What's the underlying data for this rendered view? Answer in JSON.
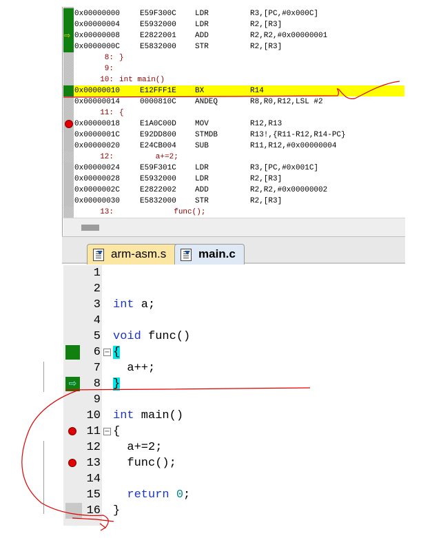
{
  "disassembly": [
    {
      "kind": "asm",
      "addr": "0x00000000",
      "hex": "E59F300C",
      "op": "LDR",
      "args": "R3,[PC,#0x000C]",
      "marker": "green"
    },
    {
      "kind": "asm",
      "addr": "0x00000004",
      "hex": "E5932000",
      "op": "LDR",
      "args": "R2,[R3]",
      "marker": "green"
    },
    {
      "kind": "asm",
      "addr": "0x00000008",
      "hex": "E2822001",
      "op": "ADD",
      "args": "R2,R2,#0x00000001",
      "marker": "arrow"
    },
    {
      "kind": "asm",
      "addr": "0x0000000C",
      "hex": "E5832000",
      "op": "STR",
      "args": "R2,[R3]",
      "marker": "green"
    },
    {
      "kind": "src",
      "num": "8:",
      "code": "}"
    },
    {
      "kind": "src",
      "num": "9:",
      "code": ""
    },
    {
      "kind": "src",
      "num": "10:",
      "code": "int main()"
    },
    {
      "kind": "asm",
      "addr": "0x00000010",
      "hex": "E12FFF1E",
      "op": "BX",
      "args": "R14",
      "marker": "green",
      "highlight": true
    },
    {
      "kind": "asm",
      "addr": "0x00000014",
      "hex": "0000810C",
      "op": "ANDEQ",
      "args": "R8,R0,R12,LSL #2"
    },
    {
      "kind": "src",
      "num": "11:",
      "code": "{"
    },
    {
      "kind": "asm",
      "addr": "0x00000018",
      "hex": "E1A0C00D",
      "op": "MOV",
      "args": "R12,R13",
      "marker": "bp"
    },
    {
      "kind": "asm",
      "addr": "0x0000001C",
      "hex": "E92DD800",
      "op": "STMDB",
      "args": "R13!,{R11-R12,R14-PC}",
      "marker": "gray"
    },
    {
      "kind": "asm",
      "addr": "0x00000020",
      "hex": "E24CB004",
      "op": "SUB",
      "args": "R11,R12,#0x00000004",
      "marker": "gray"
    },
    {
      "kind": "src",
      "num": "12:",
      "code": "        a+=2;"
    },
    {
      "kind": "asm",
      "addr": "0x00000024",
      "hex": "E59F301C",
      "op": "LDR",
      "args": "R3,[PC,#0x001C]",
      "marker": "gray"
    },
    {
      "kind": "asm",
      "addr": "0x00000028",
      "hex": "E5932000",
      "op": "LDR",
      "args": "R2,[R3]",
      "marker": "gray"
    },
    {
      "kind": "asm",
      "addr": "0x0000002C",
      "hex": "E2822002",
      "op": "ADD",
      "args": "R2,R2,#0x00000002",
      "marker": "gray"
    },
    {
      "kind": "asm",
      "addr": "0x00000030",
      "hex": "E5832000",
      "op": "STR",
      "args": "R2,[R3]",
      "marker": "gray"
    },
    {
      "kind": "src",
      "num": "13:",
      "code": "            func();"
    }
  ],
  "tabs": [
    {
      "label": "arm-asm.s",
      "active": false,
      "color": "#fbe6a3"
    },
    {
      "label": "main.c",
      "active": true,
      "color": "#dfe8f5"
    }
  ],
  "editor": [
    {
      "n": "1",
      "parts": []
    },
    {
      "n": "2",
      "parts": []
    },
    {
      "n": "3",
      "parts": [
        {
          "t": "int",
          "c": "kw"
        },
        {
          "t": " a;"
        }
      ]
    },
    {
      "n": "4",
      "parts": []
    },
    {
      "n": "5",
      "parts": [
        {
          "t": "void",
          "c": "kw"
        },
        {
          "t": " func()"
        }
      ]
    },
    {
      "n": "6",
      "marker": "green",
      "fold": true,
      "parts": [
        {
          "t": "{",
          "c": "brace-hl"
        }
      ]
    },
    {
      "n": "7",
      "parts": [
        {
          "t": "  a++;"
        }
      ]
    },
    {
      "n": "8",
      "marker": "arrow",
      "parts": [
        {
          "t": "}",
          "c": "brace-hl"
        }
      ]
    },
    {
      "n": "9",
      "parts": []
    },
    {
      "n": "10",
      "parts": [
        {
          "t": "int",
          "c": "kw"
        },
        {
          "t": " main()"
        }
      ]
    },
    {
      "n": "11",
      "marker": "bp",
      "fold": true,
      "parts": [
        {
          "t": "{"
        }
      ]
    },
    {
      "n": "12",
      "parts": [
        {
          "t": "  a+=2;"
        }
      ]
    },
    {
      "n": "13",
      "marker": "bp",
      "parts": [
        {
          "t": "  func();"
        }
      ]
    },
    {
      "n": "14",
      "parts": []
    },
    {
      "n": "15",
      "parts": [
        {
          "t": "  "
        },
        {
          "t": "return",
          "c": "kw"
        },
        {
          "t": " "
        },
        {
          "t": "0",
          "c": "num"
        },
        {
          "t": ";"
        }
      ]
    },
    {
      "n": "16",
      "marker": "gray",
      "parts": [
        {
          "t": "}"
        }
      ]
    }
  ],
  "colors": {
    "highlight": "#ffff00",
    "executed_marker": "#118011",
    "breakpoint": "#e00000",
    "keyword": "#1a36c8",
    "number": "#0a8a8a",
    "annotation_ink": "#e00000"
  }
}
